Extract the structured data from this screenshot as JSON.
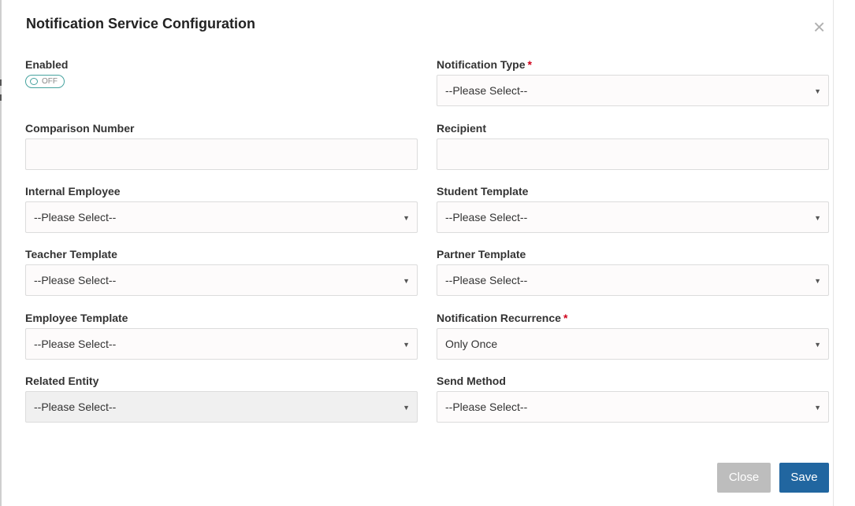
{
  "modal": {
    "title": "Notification Service Configuration",
    "close_icon": "close-x-icon"
  },
  "fields": {
    "enabled": {
      "label": "Enabled",
      "toggle_text": "OFF",
      "value": false
    },
    "notification_type": {
      "label": "Notification Type",
      "required": "*",
      "value": "--Please Select--"
    },
    "comparison_number": {
      "label": "Comparison Number",
      "value": ""
    },
    "recipient": {
      "label": "Recipient",
      "value": ""
    },
    "internal_employee": {
      "label": "Internal Employee",
      "value": "--Please Select--"
    },
    "student_template": {
      "label": "Student Template",
      "value": "--Please Select--"
    },
    "teacher_template": {
      "label": "Teacher Template",
      "value": "--Please Select--"
    },
    "partner_template": {
      "label": "Partner Template",
      "value": "--Please Select--"
    },
    "employee_template": {
      "label": "Employee Template",
      "value": "--Please Select--"
    },
    "notification_recurrence": {
      "label": "Notification Recurrence",
      "required": "*",
      "value": "Only Once"
    },
    "related_entity": {
      "label": "Related Entity",
      "value": "--Please Select--",
      "disabled": true
    },
    "send_method": {
      "label": "Send Method",
      "value": "--Please Select--"
    }
  },
  "footer": {
    "close_label": "Close",
    "save_label": "Save"
  },
  "colors": {
    "primary": "#2166a0",
    "disabled_button": "#bdbdbd",
    "required": "#d0021b",
    "toggle": "#45a29e"
  }
}
